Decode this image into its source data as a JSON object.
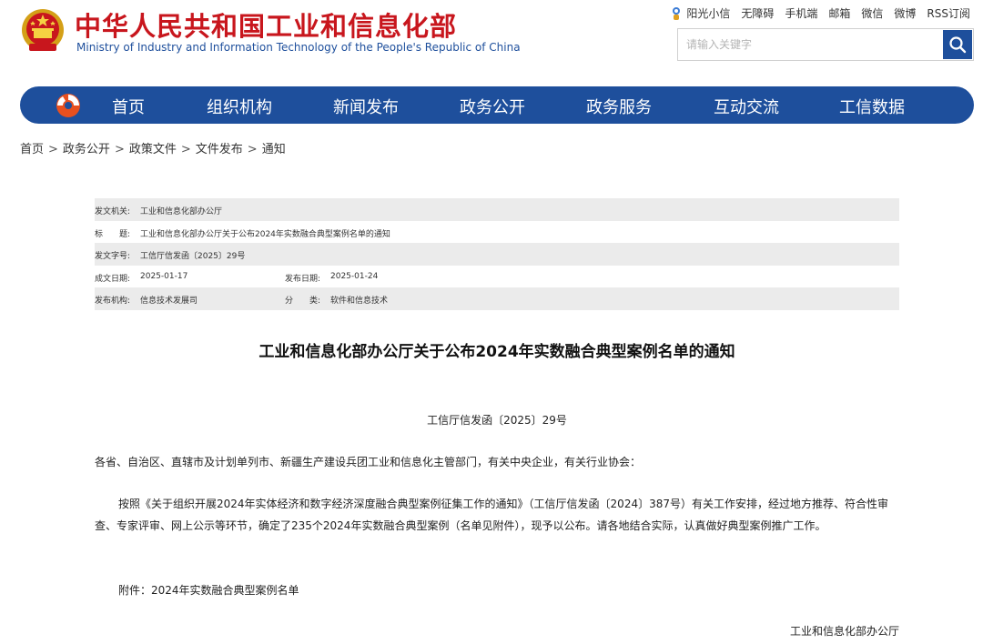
{
  "header": {
    "title_cn": "中华人民共和国工业和信息化部",
    "title_en": "Ministry of Industry and Information Technology of the People's Republic of China",
    "links": [
      "阳光小信",
      "无障碍",
      "手机端",
      "邮箱",
      "微信",
      "微博",
      "RSS订阅"
    ],
    "search_placeholder": "请输入关键字"
  },
  "nav": {
    "items": [
      "首页",
      "组织机构",
      "新闻发布",
      "政务公开",
      "政务服务",
      "互动交流",
      "工信数据"
    ]
  },
  "breadcrumb": [
    "首页",
    "政务公开",
    "政策文件",
    "文件发布",
    "通知"
  ],
  "meta": {
    "issuer_label": "发文机关:",
    "issuer_value": "工业和信息化部办公厅",
    "title_label": "标　　题:",
    "title_value": "工业和信息化部办公厅关于公布2024年实数融合典型案例名单的通知",
    "docno_label": "发文字号:",
    "docno_value": "工信厅信发函〔2025〕29号",
    "created_label": "成文日期:",
    "created_value": "2025-01-17",
    "published_label": "发布日期:",
    "published_value": "2025-01-24",
    "agency_label": "发布机构:",
    "agency_value": "信息技术发展司",
    "category_label": "分　　类:",
    "category_value": "软件和信息技术"
  },
  "document": {
    "title": "工业和信息化部办公厅关于公布2024年实数融合典型案例名单的通知",
    "number": "工信厅信发函〔2025〕29号",
    "addressee": "各省、自治区、直辖市及计划单列市、新疆生产建设兵团工业和信息化主管部门，有关中央企业，有关行业协会：",
    "body": "按照《关于组织开展2024年实体经济和数字经济深度融合典型案例征集工作的通知》（工信厅信发函〔2024〕387号）有关工作安排，经过地方推荐、符合性审查、专家评审、网上公示等环节，确定了235个2024年实数融合典型案例（名单见附件），现予以公布。请各地结合实际，认真做好典型案例推广工作。",
    "attachment": "附件：2024年实数融合典型案例名单",
    "signature": "工业和信息化部办公厅"
  },
  "colors": {
    "brand_red": "#c8161d",
    "brand_blue": "#1e4f9c",
    "meta_row_bg": "#ebebeb"
  },
  "icons": [
    "national-emblem-icon",
    "sun-mascot-icon",
    "search-icon",
    "miit-logo-icon"
  ]
}
